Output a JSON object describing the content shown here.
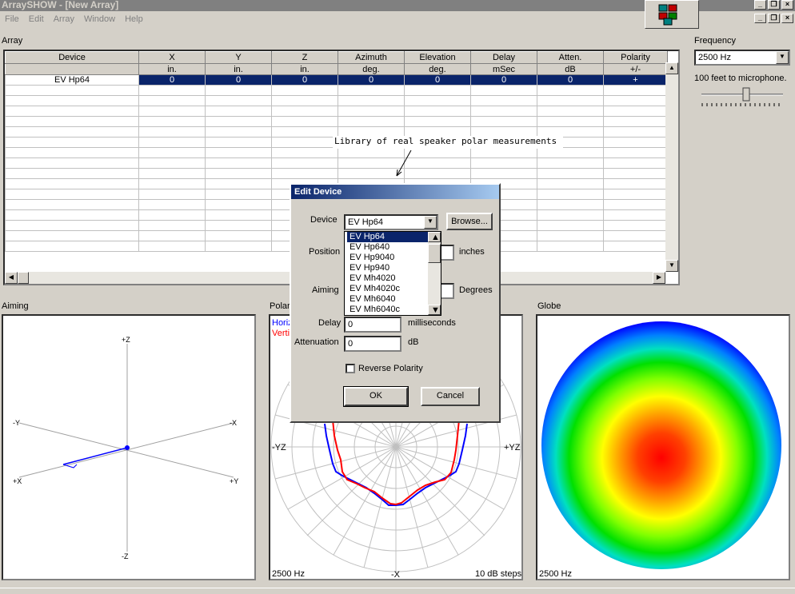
{
  "window": {
    "title": "ArraySHOW - [New Array]"
  },
  "menu": [
    "File",
    "Edit",
    "Array",
    "Window",
    "Help"
  ],
  "array": {
    "label": "Array",
    "columns": [
      "Device",
      "X",
      "Y",
      "Z",
      "Azimuth",
      "Elevation",
      "Delay",
      "Atten.",
      "Polarity"
    ],
    "units": [
      "",
      "in.",
      "in.",
      "in.",
      "deg.",
      "deg.",
      "mSec",
      "dB",
      "+/-"
    ],
    "rows": [
      [
        "EV Hp64",
        "0",
        "0",
        "0",
        "0",
        "0",
        "0",
        "0",
        "+"
      ]
    ]
  },
  "annotation": "Library of real speaker polar measurements",
  "frequency": {
    "label": "Frequency",
    "value": "2500 Hz",
    "distance": "100 feet to microphone."
  },
  "aiming": {
    "label": "Aiming",
    "axes": {
      "top": "+Z",
      "bottom": "-Z",
      "left": "-Y",
      "right": "-X",
      "bl": "+X",
      "br": "+Y"
    }
  },
  "polar": {
    "label": "Polar",
    "legend_h": "Horiz",
    "legend_v": "Verti",
    "left_axis": "-YZ",
    "right_axis": "+YZ",
    "bottom_axis": "-X",
    "freq": "2500 Hz",
    "steps": "10 dB steps",
    "colors": {
      "horizontal": "#0000ff",
      "vertical": "#ff0000"
    }
  },
  "globe": {
    "label": "Globe",
    "freq": "2500 Hz"
  },
  "dialog": {
    "title": "Edit Device",
    "device_label": "Device",
    "device_value": "EV Hp64",
    "browse": "Browse...",
    "position_label": "Position",
    "position_unit": "inches",
    "aiming_label": "Aiming",
    "aiming_unit": "Degrees",
    "delay_label": "Delay",
    "delay_value": "0",
    "delay_unit": "milliseconds",
    "atten_label": "Attenuation",
    "atten_value": "0",
    "atten_unit": "dB",
    "reverse": "Reverse Polarity",
    "ok": "OK",
    "cancel": "Cancel",
    "devices": [
      "EV Hp64",
      "EV Hp640",
      "EV Hp9040",
      "EV Hp940",
      "EV Mh4020",
      "EV Mh4020c",
      "EV Mh6040",
      "EV Mh6040c"
    ]
  }
}
